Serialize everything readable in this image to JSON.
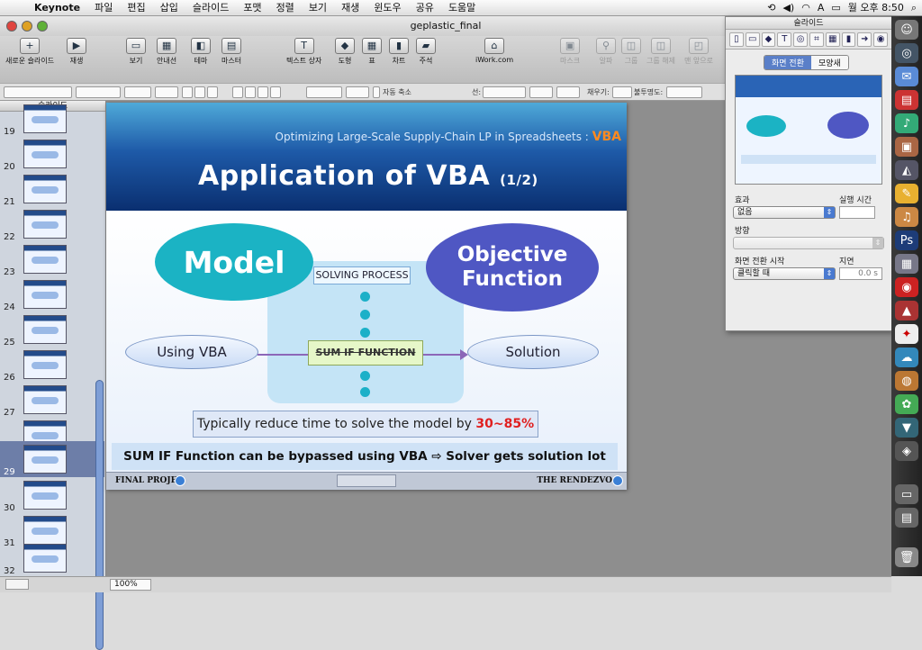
{
  "menubar": {
    "app": "Keynote",
    "items": [
      "파일",
      "편집",
      "삽입",
      "슬라이드",
      "포맷",
      "정렬",
      "보기",
      "재생",
      "윈도우",
      "공유",
      "도움말"
    ],
    "clock": "월 오후 8:50"
  },
  "window": {
    "title": "geplastic_final"
  },
  "toolbar": {
    "new_slide": "새로운 슬라이드",
    "play": "재생",
    "view": "보기",
    "guides": "안내선",
    "themes": "테마",
    "masters": "마스터",
    "text_box": "텍스트 상자",
    "shapes": "도형",
    "table": "표",
    "chart": "차트",
    "comment": "주석",
    "iwork": "iWork.com",
    "mask": "마스크",
    "alpha": "알파",
    "group": "그룹",
    "ungroup": "그룹 해제",
    "send_back": "맨 앞으로"
  },
  "formatbar": {
    "autoshrink": "자동 축소",
    "line_label": "선:",
    "fill_label": "채우기:",
    "opacity_label": "불투명도:"
  },
  "sidebar": {
    "header": "슬라이드",
    "slides": [
      "19",
      "20",
      "21",
      "22",
      "23",
      "24",
      "25",
      "26",
      "27",
      "28",
      "29",
      "30",
      "31",
      "32"
    ],
    "selected": "29"
  },
  "slide": {
    "subtitle": "Optimizing Large-Scale Supply-Chain  LP in Spreadsheets :",
    "subtitle_accent": "VBA",
    "title": "Application of VBA",
    "title_part": "(1/2)",
    "model": "Model",
    "objective_1": "Objective",
    "objective_2": "Function",
    "solving_process": "SOLVING PROCESS",
    "using_vba": "Using VBA",
    "sum_if": "SUM IF FUNCTION",
    "solution": "Solution",
    "reduce_text": "Typically reduce time to solve the model by",
    "reduce_pct": "30~85%",
    "bypass": "SUM IF Function can be bypassed using VBA ⇨  Solver gets solution lot faster!",
    "footer_left": "FINAL PROJEC",
    "footer_right": "THE RENDEZVO"
  },
  "bottombar": {
    "zoom": "100%"
  },
  "inspector": {
    "title": "슬라이드",
    "tab_transition": "화면 전환",
    "tab_appearance": "모양새",
    "effect_label": "효과",
    "duration_label": "실행 시간",
    "effect_value": "없음",
    "direction_label": "방향",
    "start_label": "화면 전환 시작",
    "delay_label": "지연",
    "start_value": "클릭할 때",
    "delay_value": "0.0 s"
  }
}
